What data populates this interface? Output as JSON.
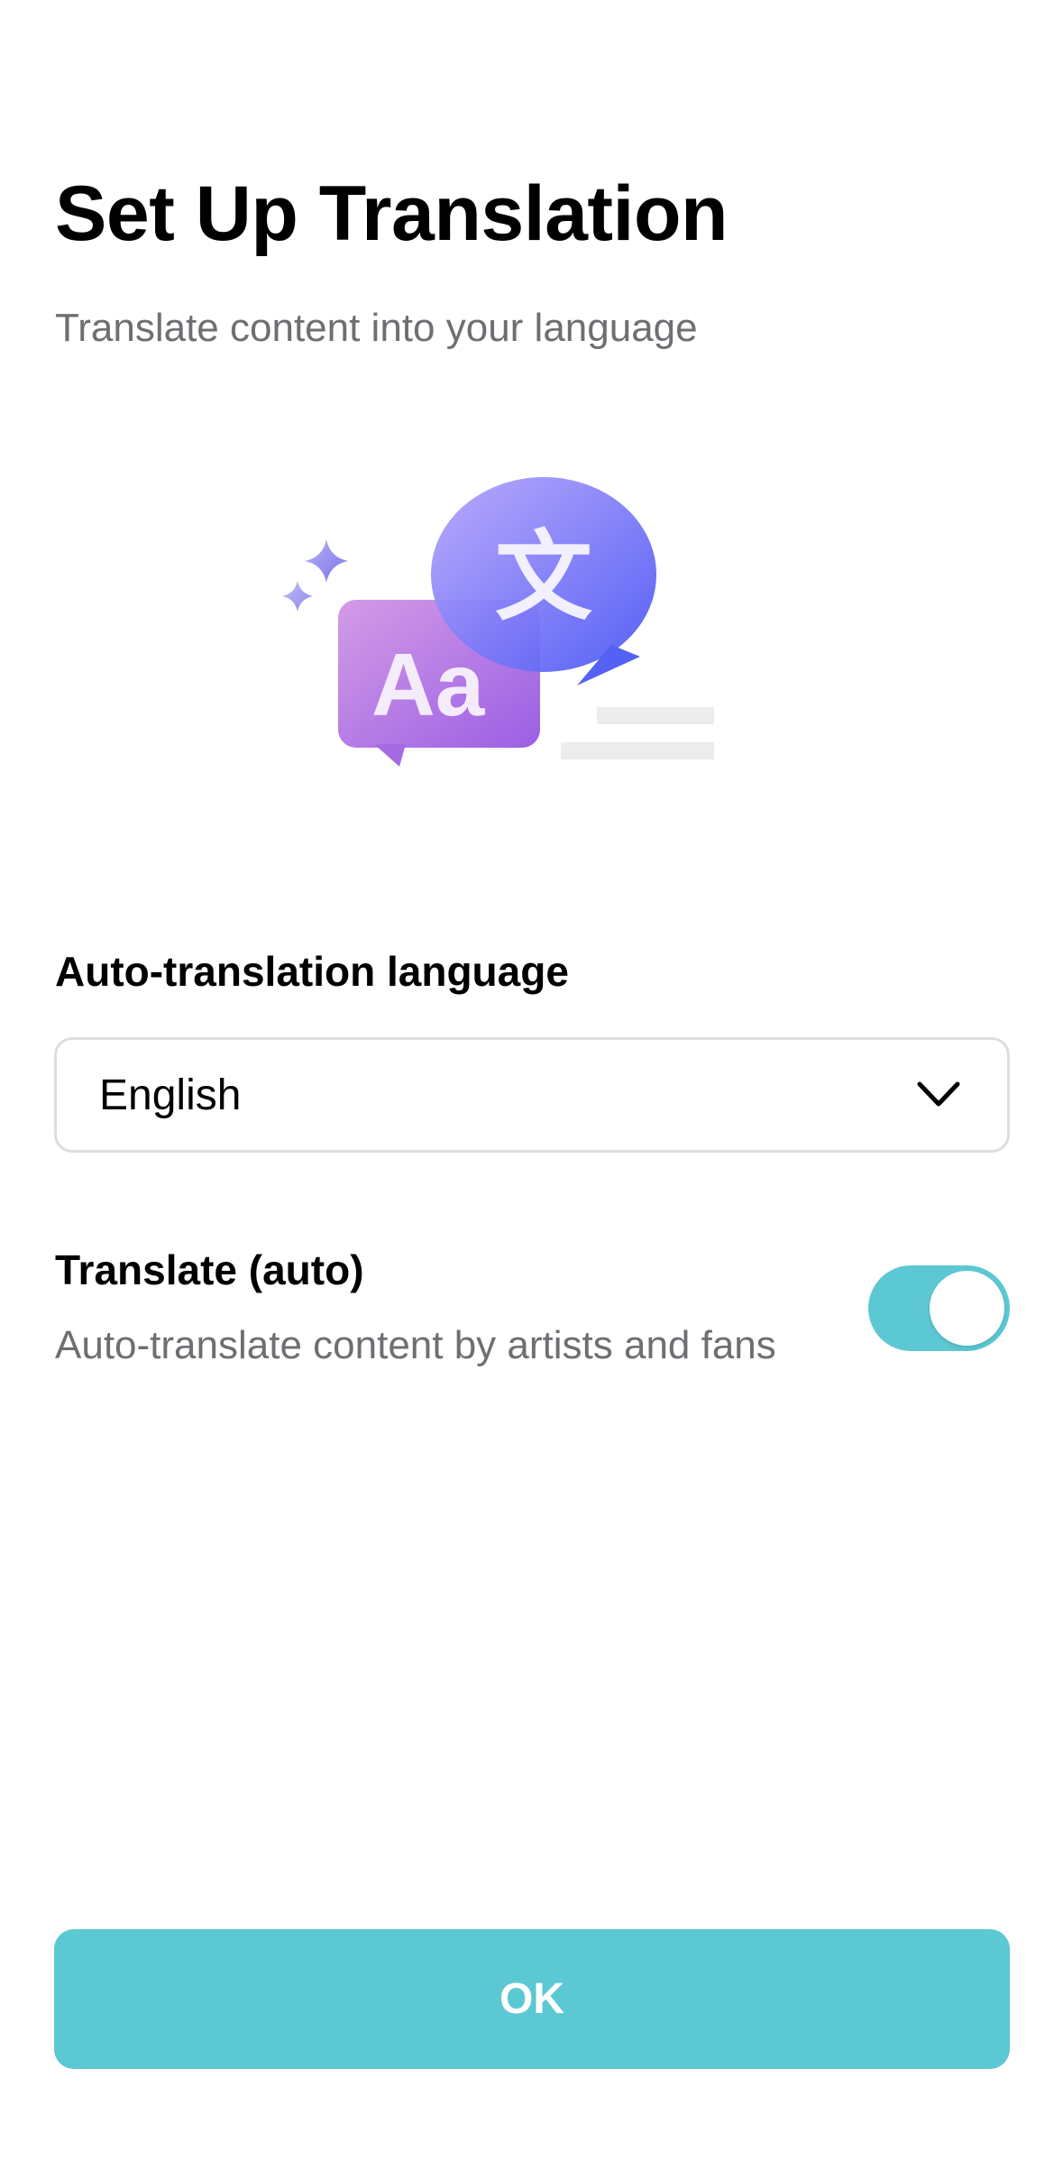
{
  "header": {
    "title": "Set Up Translation",
    "subtitle": "Translate content into your language"
  },
  "illustration": {
    "source_bubble_text": "Aa",
    "target_bubble_text": "文",
    "icon": "translate-bubbles-icon"
  },
  "language": {
    "label": "Auto-translation language",
    "selected": "English",
    "icon": "chevron-down-icon"
  },
  "auto_translate": {
    "title": "Translate (auto)",
    "description": "Auto-translate content by artists and fans",
    "enabled": true
  },
  "footer": {
    "ok_label": "OK"
  },
  "colors": {
    "accent": "#5cc8d3",
    "title_text": "#000000",
    "secondary_text": "#6e6e73",
    "border": "#dedede",
    "bubble_purple": "#a468e0",
    "bubble_blue": "#5a63f5"
  }
}
